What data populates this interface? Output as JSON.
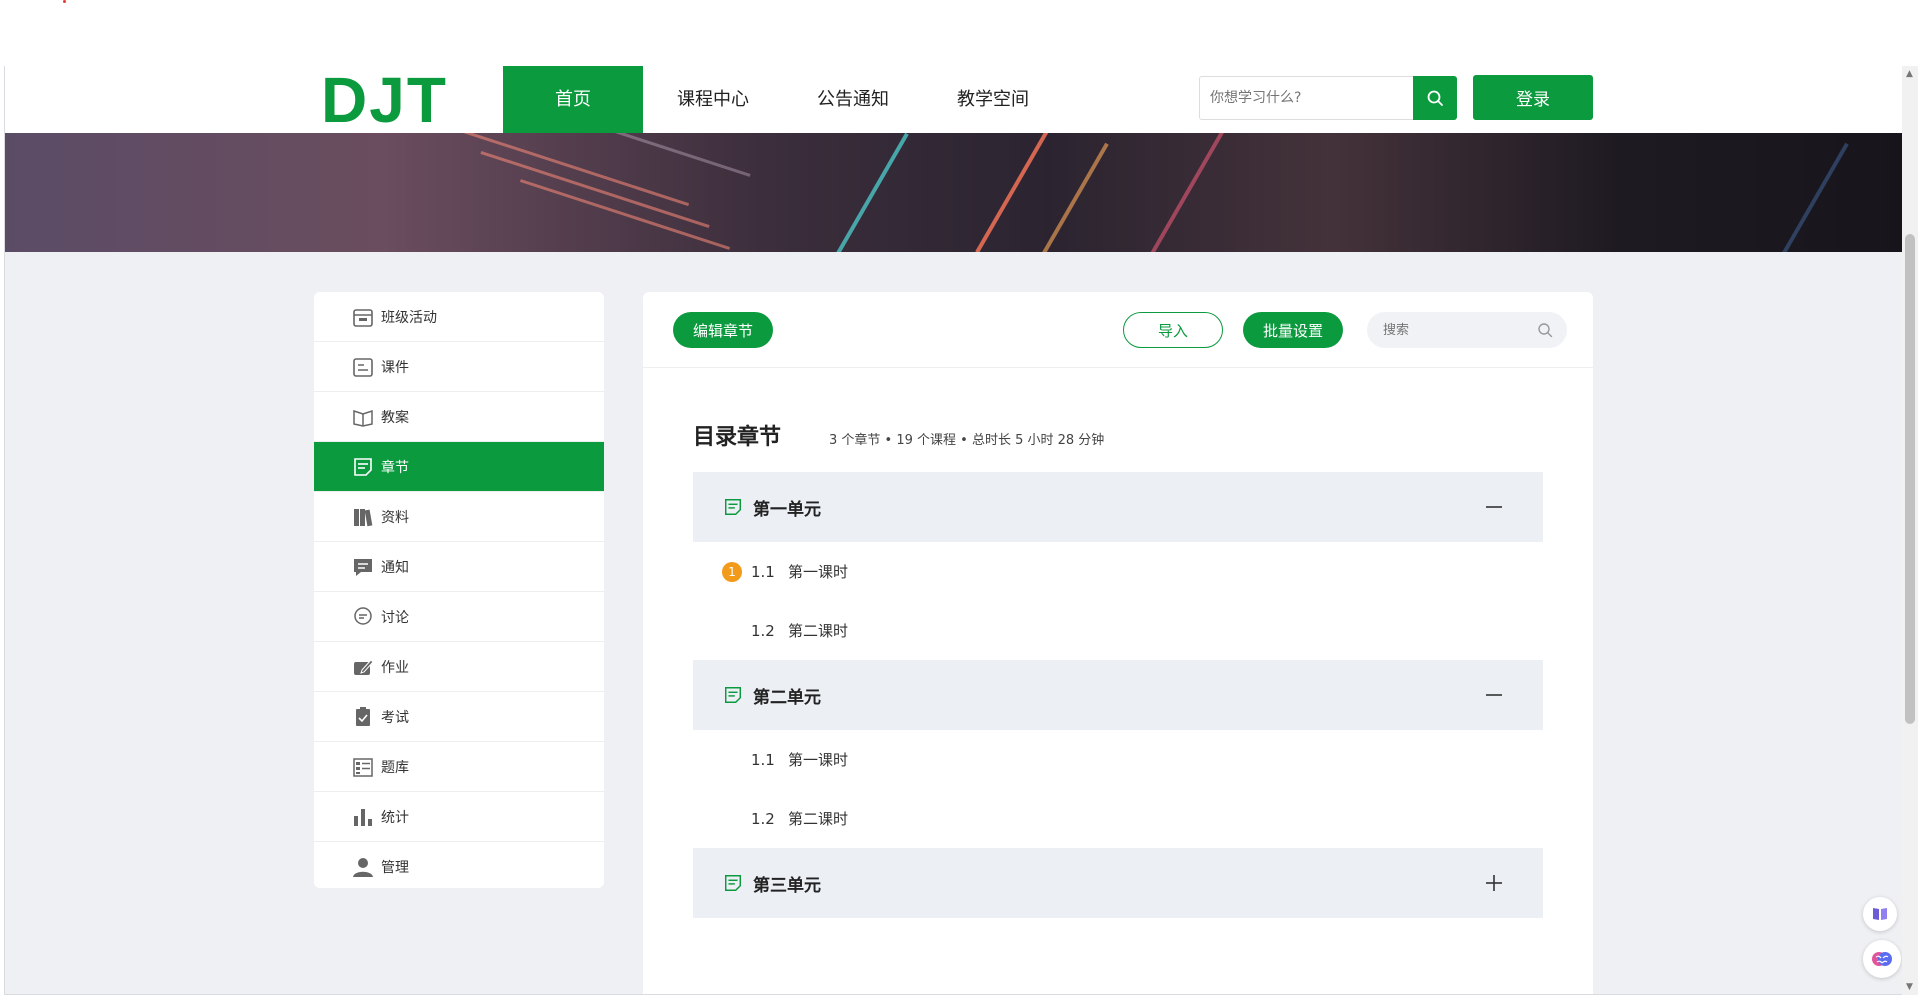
{
  "header": {
    "logo": "DJT",
    "nav": [
      "首页",
      "课程中心",
      "公告通知",
      "教学空间"
    ],
    "search_placeholder": "你想学习什么?",
    "login_label": "登录"
  },
  "sidebar": {
    "items": [
      {
        "label": "班级活动",
        "icon": "calendar-icon"
      },
      {
        "label": "课件",
        "icon": "courseware-icon"
      },
      {
        "label": "教案",
        "icon": "book-icon"
      },
      {
        "label": "章节",
        "icon": "chapter-icon",
        "active": true
      },
      {
        "label": "资料",
        "icon": "library-icon"
      },
      {
        "label": "通知",
        "icon": "message-icon"
      },
      {
        "label": "讨论",
        "icon": "discussion-icon"
      },
      {
        "label": "作业",
        "icon": "homework-icon"
      },
      {
        "label": "考试",
        "icon": "exam-icon"
      },
      {
        "label": "题库",
        "icon": "question-bank-icon"
      },
      {
        "label": "统计",
        "icon": "chart-icon"
      },
      {
        "label": "管理",
        "icon": "user-icon"
      }
    ]
  },
  "toolbar": {
    "edit_label": "编辑章节",
    "import_label": "导入",
    "batch_label": "批量设置",
    "search_placeholder": "搜索"
  },
  "catalog": {
    "title": "目录章节",
    "meta": "3 个章节 • 19 个课程 • 总时长 5 小时 28 分钟",
    "units": [
      {
        "title": "第一单元",
        "expanded": true,
        "lessons": [
          {
            "num": "1.1",
            "title": "第一课时",
            "badge": "1"
          },
          {
            "num": "1.2",
            "title": "第二课时"
          }
        ]
      },
      {
        "title": "第二单元",
        "expanded": true,
        "lessons": [
          {
            "num": "1.1",
            "title": "第一课时"
          },
          {
            "num": "1.2",
            "title": "第二课时"
          }
        ]
      },
      {
        "title": "第三单元",
        "expanded": false,
        "lessons": []
      }
    ]
  },
  "colors": {
    "brand": "#0b9a3e",
    "badge": "#f29a1a",
    "unit_bg": "#eceff4",
    "page_bg": "#eef0f4"
  }
}
